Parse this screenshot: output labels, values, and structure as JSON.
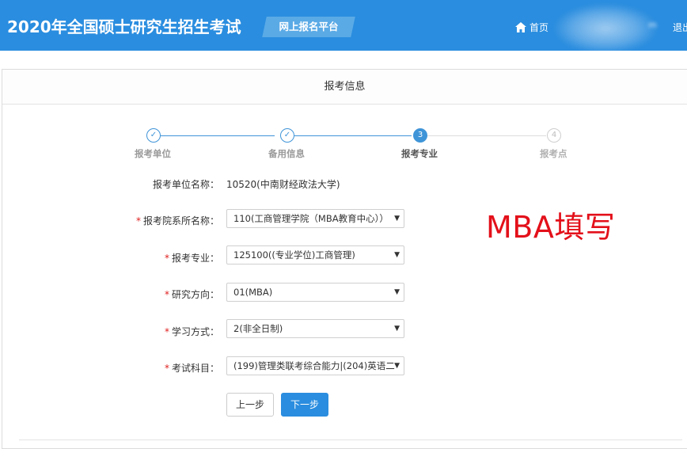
{
  "header": {
    "title": "2020年全国硕士研究生招生考试",
    "badge": "网上报名平台",
    "home_label": "首页",
    "user_name": "m",
    "logout_label": "退出"
  },
  "panel": {
    "title": "报考信息"
  },
  "steps": [
    {
      "marker": "✓",
      "label": "报考单位"
    },
    {
      "marker": "✓",
      "label": "备用信息"
    },
    {
      "marker": "3",
      "label": "报考专业"
    },
    {
      "marker": "4",
      "label": "报考点"
    }
  ],
  "form": {
    "unit_label": "报考单位名称：",
    "unit_value": "10520(中南财经政法大学)",
    "dept_label": "报考院系所名称：",
    "dept_value": "110(工商管理学院（MBA教育中心））",
    "major_label": "报考专业：",
    "major_value": "125100((专业学位)工商管理)",
    "direction_label": "研究方向：",
    "direction_value": "01(MBA)",
    "mode_label": "学习方式：",
    "mode_value": "2(非全日制)",
    "subject_label": "考试科目：",
    "subject_value": "(199)管理类联考综合能力|(204)英语二",
    "required_mark": "*"
  },
  "annotation": "MBA填写",
  "buttons": {
    "prev": "上一步",
    "next": "下一步"
  },
  "colors": {
    "header_bg": "#2a8ddf",
    "step_active": "#3f94d8",
    "annotation_red": "#e3101a",
    "required_red": "#e02020"
  }
}
